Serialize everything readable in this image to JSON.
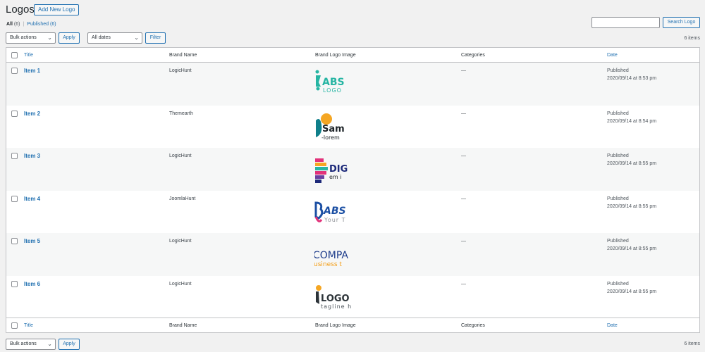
{
  "page": {
    "title": "Logos",
    "add_new_label": "Add New Logo"
  },
  "filters": {
    "all_label": "All",
    "all_count": "(6)",
    "separator": "|",
    "published_label": "Published",
    "published_count": "(6)",
    "bulk_actions_label": "Bulk actions",
    "apply_label": "Apply",
    "dates_label": "All dates",
    "filter_label": "Filter",
    "items_count": "6 items"
  },
  "search": {
    "button_label": "Search Logo",
    "value": ""
  },
  "columns": {
    "title": "Title",
    "brand": "Brand Name",
    "logo": "Brand Logo Image",
    "categories": "Categories",
    "date": "Date"
  },
  "rows": [
    {
      "title": "Item 1",
      "brand": "LogicHunt",
      "logo_text": "ABS",
      "logo_sub": "LOGO",
      "categories": "—",
      "status": "Published",
      "date": "2020/09/14 at 8:53 pm"
    },
    {
      "title": "Item 2",
      "brand": "Themearth",
      "logo_text": "Sam",
      "logo_sub": "-lorem",
      "categories": "—",
      "status": "Published",
      "date": "2020/09/14 at 8:54 pm"
    },
    {
      "title": "Item 3",
      "brand": "LogicHunt",
      "logo_text": "DIG",
      "logo_sub": "em i",
      "categories": "—",
      "status": "Published",
      "date": "2020/09/14 at 8:55 pm"
    },
    {
      "title": "Item 4",
      "brand": "JoomlaHunt",
      "logo_text": "ABS",
      "logo_sub": "Your T",
      "categories": "—",
      "status": "Published",
      "date": "2020/09/14 at 8:55 pm"
    },
    {
      "title": "Item 5",
      "brand": "LogicHunt",
      "logo_text": "COMPA",
      "logo_sub": "usiness t",
      "categories": "—",
      "status": "Published",
      "date": "2020/09/14 at 8:55 pm"
    },
    {
      "title": "Item 6",
      "brand": "LogicHunt",
      "logo_text": "LOGO T",
      "logo_sub": "tagline he",
      "categories": "—",
      "status": "Published",
      "date": "2020/09/14 at 8:55 pm"
    }
  ],
  "colors": {
    "link": "#2271b1",
    "logo1": "#26b5a3",
    "logo2_orange": "#f5a623",
    "logo2_teal": "#0f7f8a",
    "logo3_blue": "#1d2a7a",
    "logo3_pink": "#e2327a",
    "logo3_purple": "#6a3fa0",
    "logo4_blue": "#1b4fa3",
    "logo4_pink": "#e2327a",
    "logo5_blue": "#1b3a8a",
    "logo5_orange": "#f39c12",
    "logo6_orange": "#f5a623",
    "logo6_dark": "#2c3338"
  }
}
